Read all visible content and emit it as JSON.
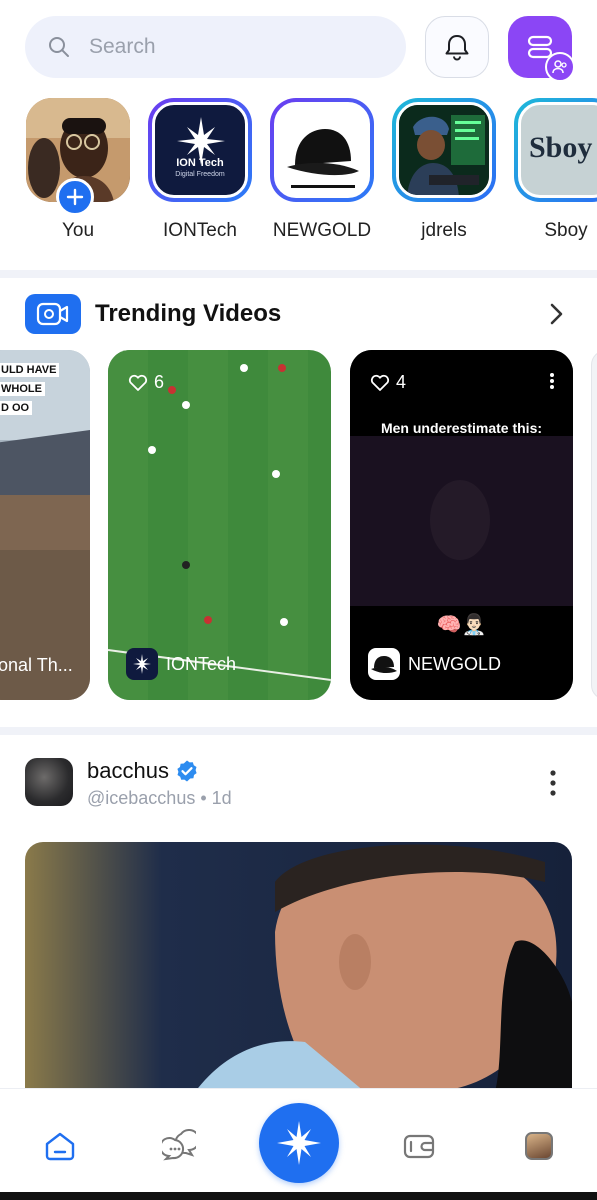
{
  "search": {
    "placeholder": "Search"
  },
  "stories": [
    {
      "label": "You"
    },
    {
      "label": "IONTech",
      "logo_text": "ION Tech",
      "logo_sub": "Digital Freedom"
    },
    {
      "label": "NEWGOLD"
    },
    {
      "label": "jdrels"
    },
    {
      "label": "Sboy",
      "logo_text": "Sboy"
    }
  ],
  "trending": {
    "title": "Trending Videos",
    "videos": [
      {
        "overlay_lines": [
          "ULD HAVE",
          "WHOLE",
          "D OO"
        ],
        "caption": "onal Th..."
      },
      {
        "likes": "6",
        "author": "IONTech"
      },
      {
        "likes": "4",
        "headline": "Men underestimate this:",
        "emoji": "🧠👨🏻‍⚕️",
        "author": "NEWGOLD"
      }
    ]
  },
  "post": {
    "name": "bacchus",
    "handle": "@icebacchus",
    "time": "1d",
    "separator": "•"
  },
  "colors": {
    "accent": "#1f6ff0",
    "menu_purple": "#8b46f5",
    "search_bg": "#eef1fb",
    "verified": "#2d8cf0"
  },
  "icons": [
    "search-icon",
    "bell-icon",
    "menu-icon",
    "people-icon",
    "plus-icon",
    "video-camera-icon",
    "chevron-right-icon",
    "heart-icon",
    "more-vertical-icon",
    "verified-badge-icon",
    "home-icon",
    "chat-icon",
    "star-logo-icon",
    "wallet-icon"
  ]
}
